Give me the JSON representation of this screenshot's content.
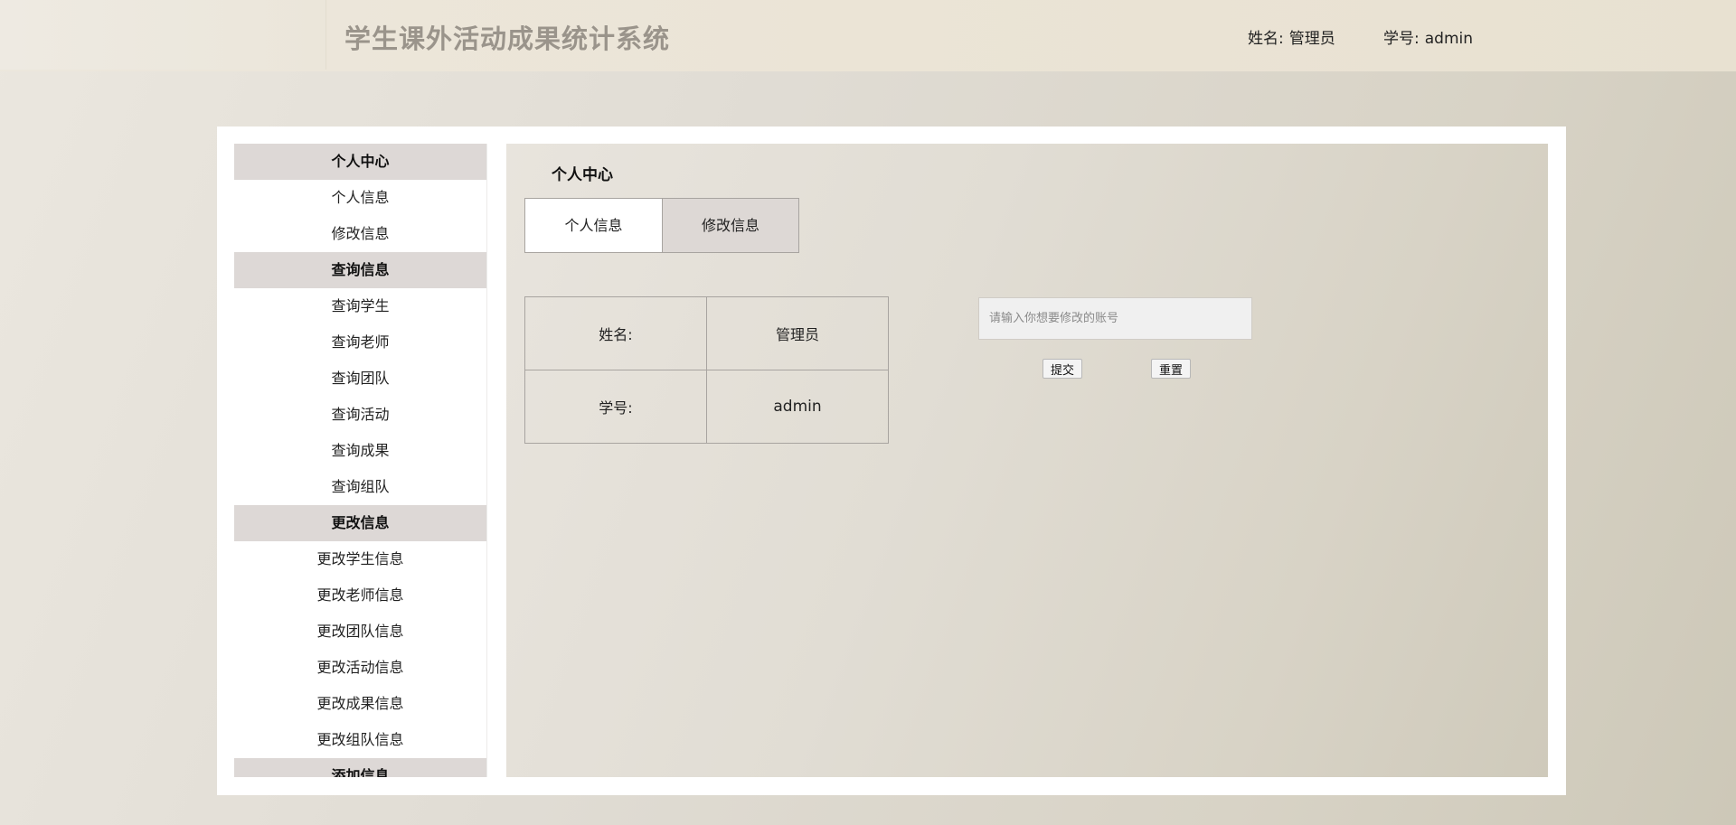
{
  "header": {
    "app_title": "学生课外活动成果统计系统",
    "name_label": "姓名:",
    "name_value": "管理员",
    "id_label": "学号:",
    "id_value": "admin"
  },
  "sidebar": {
    "items": [
      {
        "label": "个人中心",
        "group": true
      },
      {
        "label": "个人信息",
        "group": false
      },
      {
        "label": "修改信息",
        "group": false
      },
      {
        "label": "查询信息",
        "group": true
      },
      {
        "label": "查询学生",
        "group": false
      },
      {
        "label": "查询老师",
        "group": false
      },
      {
        "label": "查询团队",
        "group": false
      },
      {
        "label": "查询活动",
        "group": false
      },
      {
        "label": "查询成果",
        "group": false
      },
      {
        "label": "查询组队",
        "group": false
      },
      {
        "label": "更改信息",
        "group": true
      },
      {
        "label": "更改学生信息",
        "group": false
      },
      {
        "label": "更改老师信息",
        "group": false
      },
      {
        "label": "更改团队信息",
        "group": false
      },
      {
        "label": "更改活动信息",
        "group": false
      },
      {
        "label": "更改成果信息",
        "group": false
      },
      {
        "label": "更改组队信息",
        "group": false
      },
      {
        "label": "添加信息",
        "group": true
      }
    ]
  },
  "main": {
    "title": "个人中心",
    "tabs": [
      {
        "label": "个人信息",
        "active": true
      },
      {
        "label": "修改信息",
        "active": false
      }
    ],
    "info_rows": [
      {
        "label": "姓名:",
        "value": "管理员"
      },
      {
        "label": "学号:",
        "value": "admin"
      }
    ],
    "modify_form": {
      "placeholder": "请输入你想要修改的账号",
      "value": "",
      "submit_label": "提交",
      "reset_label": "重置"
    }
  }
}
